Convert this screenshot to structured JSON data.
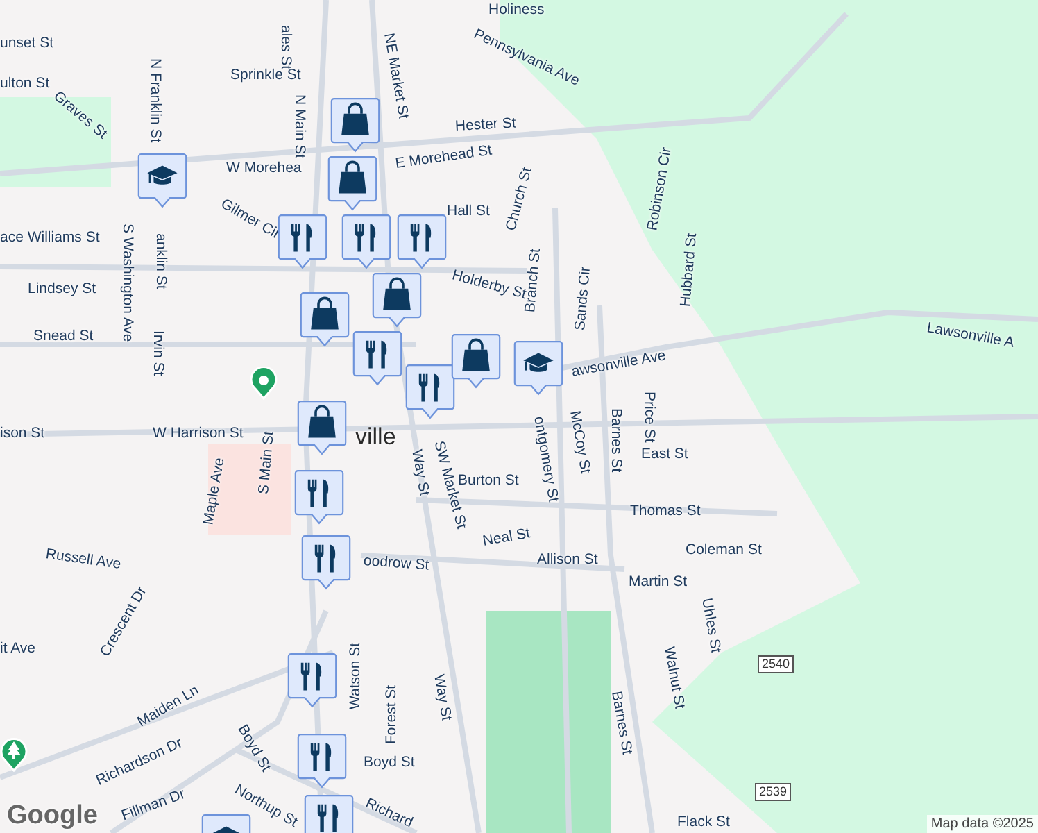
{
  "map": {
    "street_labels": [
      "unset St",
      "ulton St",
      "Graves St",
      "N Franklin St",
      "Sprinkle St",
      "ales St",
      "NE Market St",
      "Hester St",
      "W Morehea",
      "E Morehead St",
      "Gilmer Cir",
      "Hall St",
      "N Main St",
      "ace Williams St",
      "S Washington Ave",
      "anklin St",
      "Holderby St",
      "Church St",
      "Lindsey St",
      "Irvin St",
      "Snead St",
      "Branch St",
      "Sands Cir",
      "Robinson Cir",
      "Hubbard St",
      "awsonville Ave",
      "Lawsonville A",
      "Pennsylvania Ave",
      "W Harrison St",
      "ison St",
      "Maple Ave",
      "S Main St",
      "Way St",
      "SW Market St",
      "Burton St",
      "ontgomery St",
      "McCoy St",
      "Barnes St",
      "Price St",
      "East St",
      "Thomas St",
      "Neal St",
      "Coleman St",
      "Allison St",
      "Martin St",
      "Uhles St",
      "Russell Ave",
      "oodrow St",
      "Crescent Dr",
      "Walnut St",
      "it Ave",
      "Way St",
      "Watson St",
      "Forest St",
      "Barnes St",
      "Boyd St",
      "Maiden Ln",
      "Boyd St",
      "Richardson Dr",
      "Northup St",
      "Fillman Dr",
      "Richard",
      "Flack St",
      "Holiness"
    ],
    "town_label": "ville",
    "route_shields": [
      "2540",
      "2539"
    ],
    "pins": [
      {
        "kind": "shopping"
      },
      {
        "kind": "shopping"
      },
      {
        "kind": "school"
      },
      {
        "kind": "dining"
      },
      {
        "kind": "dining"
      },
      {
        "kind": "dining"
      },
      {
        "kind": "shopping"
      },
      {
        "kind": "shopping"
      },
      {
        "kind": "dining"
      },
      {
        "kind": "dining"
      },
      {
        "kind": "shopping"
      },
      {
        "kind": "school"
      },
      {
        "kind": "shopping"
      },
      {
        "kind": "dining"
      },
      {
        "kind": "dining"
      },
      {
        "kind": "dining"
      },
      {
        "kind": "dining"
      },
      {
        "kind": "dining"
      },
      {
        "kind": "school"
      },
      {
        "kind": "place"
      },
      {
        "kind": "park"
      }
    ]
  },
  "attribution": "Map data ©2025",
  "logo": "Google"
}
